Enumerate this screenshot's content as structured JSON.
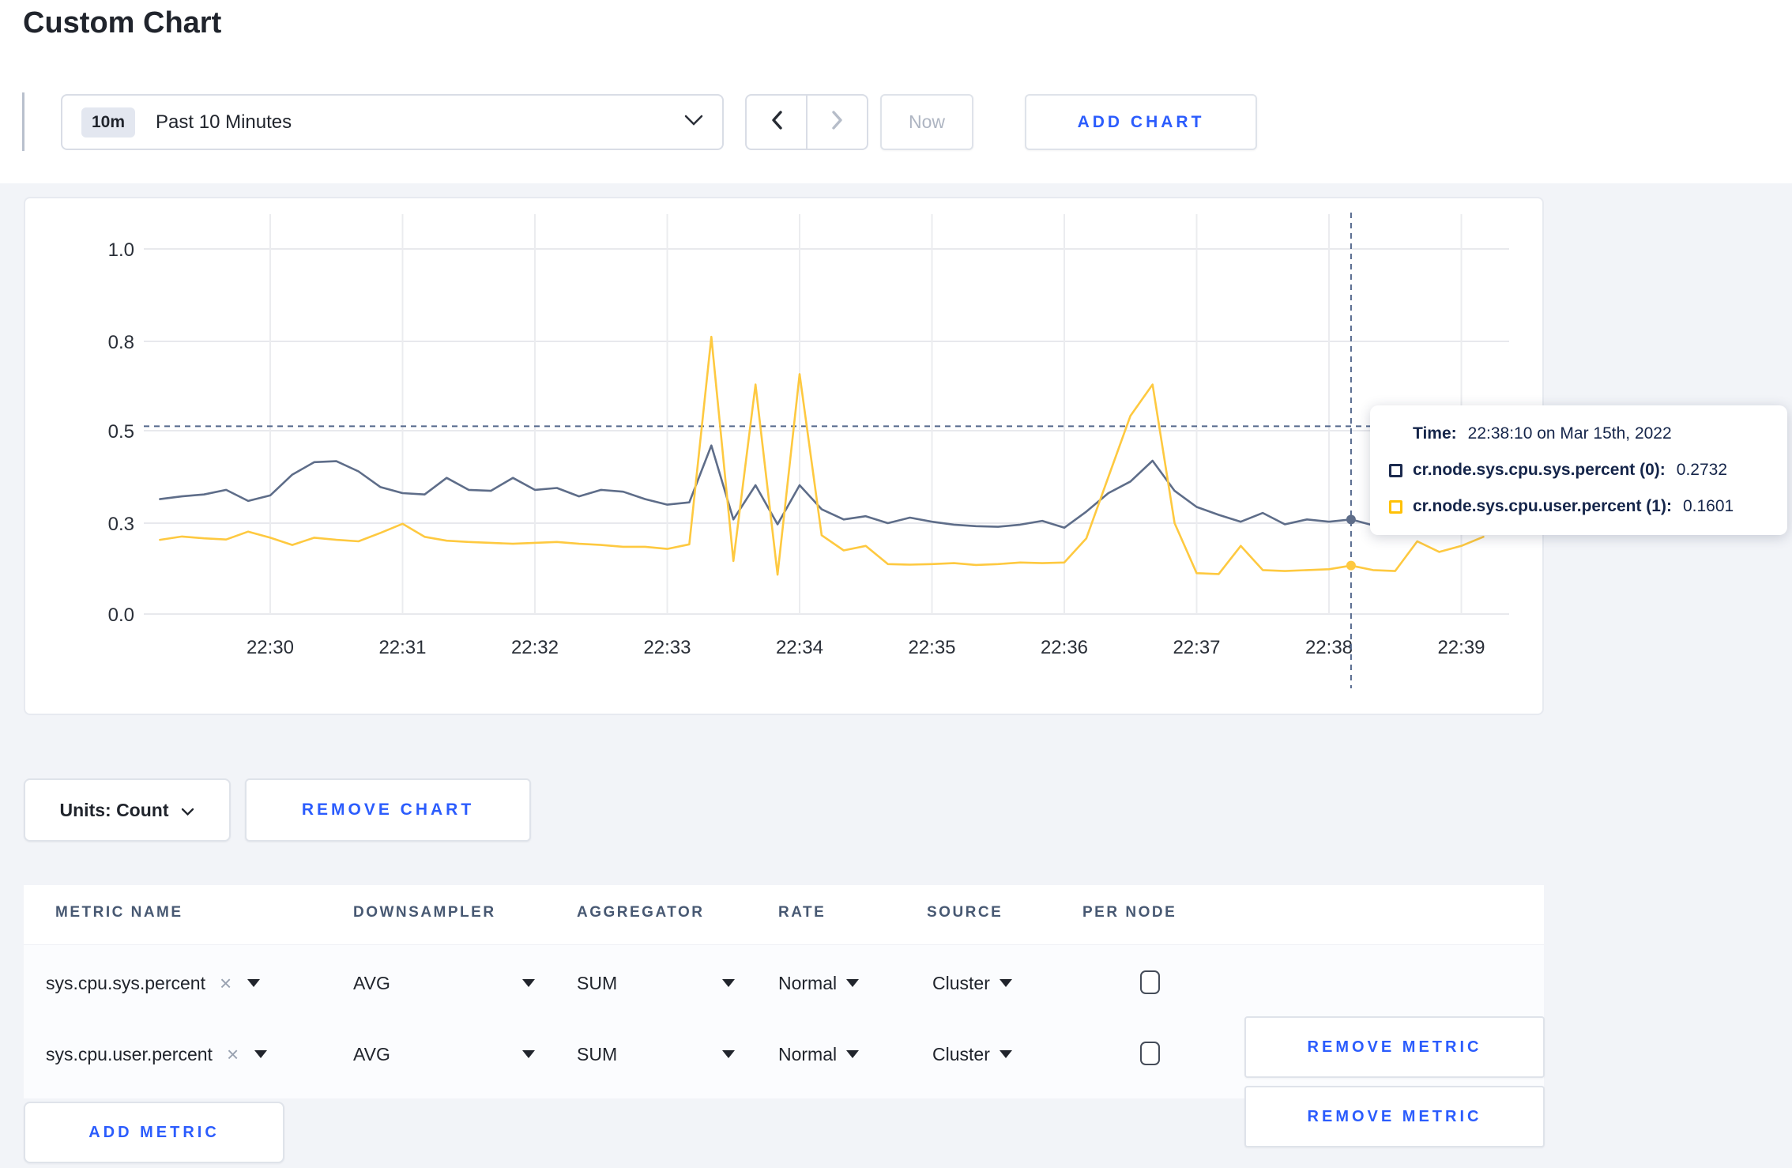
{
  "page": {
    "title": "Custom Chart"
  },
  "toolbar": {
    "range_badge": "10m",
    "range_label": "Past 10 Minutes",
    "now_label": "Now",
    "add_chart_label": "ADD CHART"
  },
  "chart_data": {
    "type": "line",
    "title": "",
    "xlabel": "",
    "ylabel": "",
    "x_ticks": [
      "22:30",
      "22:31",
      "22:32",
      "22:33",
      "22:34",
      "22:35",
      "22:36",
      "22:37",
      "22:38",
      "22:39"
    ],
    "y_ticks": [
      0.0,
      0.3,
      0.5,
      0.8,
      1.0
    ],
    "ylim": [
      0.0,
      1.0
    ],
    "grid": true,
    "sample_interval_seconds": 10,
    "series": [
      {
        "name": "cr.node.sys.cpu.sys.percent (0)",
        "color": "#5e6d89",
        "values": [
          0.352,
          0.358,
          0.362,
          0.372,
          0.348,
          0.36,
          0.405,
          0.432,
          0.434,
          0.412,
          0.378,
          0.365,
          0.362,
          0.398,
          0.372,
          0.37,
          0.398,
          0.372,
          0.376,
          0.358,
          0.372,
          0.368,
          0.352,
          0.34,
          0.345,
          0.468,
          0.308,
          0.382,
          0.296,
          0.382,
          0.33,
          0.308,
          0.315,
          0.3,
          0.312,
          0.303,
          0.295,
          0.29,
          0.288,
          0.295,
          0.305,
          0.285,
          0.325,
          0.365,
          0.39,
          0.435,
          0.37,
          0.335,
          0.318,
          0.303,
          0.322,
          0.296,
          0.308,
          0.303,
          0.308,
          0.293,
          0.3,
          0.318,
          0.298,
          0.308,
          0.315
        ]
      },
      {
        "name": "cr.node.sys.cpu.user.percent (1)",
        "color": "#fec940",
        "values": [
          0.245,
          0.256,
          0.25,
          0.246,
          0.272,
          0.252,
          0.228,
          0.252,
          0.245,
          0.24,
          0.268,
          0.298,
          0.255,
          0.242,
          0.238,
          0.235,
          0.232,
          0.235,
          0.238,
          0.232,
          0.228,
          0.222,
          0.222,
          0.215,
          0.23,
          0.81,
          0.175,
          0.655,
          0.13,
          0.69,
          0.26,
          0.21,
          0.225,
          0.165,
          0.163,
          0.165,
          0.168,
          0.162,
          0.165,
          0.17,
          0.168,
          0.17,
          0.25,
          0.4,
          0.55,
          0.655,
          0.3,
          0.135,
          0.132,
          0.225,
          0.145,
          0.142,
          0.145,
          0.148,
          0.16,
          0.145,
          0.142,
          0.24,
          0.205,
          0.225,
          0.255
        ]
      }
    ],
    "crosshair": {
      "index": 54,
      "time": "22:38:10",
      "y_value": 0.515,
      "color": "#54688c"
    }
  },
  "tooltip": {
    "time_label": "Time:",
    "time_value": "22:38:10 on Mar 15th, 2022",
    "rows": [
      {
        "label": "cr.node.sys.cpu.sys.percent (0):",
        "value": "0.2732",
        "swatch_color": "#1b2a4e"
      },
      {
        "label": "cr.node.sys.cpu.user.percent (1):",
        "value": "0.1601",
        "swatch_color": "#ffc107"
      }
    ]
  },
  "chart_footer": {
    "units_label": "Units: Count",
    "remove_chart_label": "REMOVE CHART"
  },
  "metrics_table": {
    "headers": [
      "METRIC NAME",
      "DOWNSAMPLER",
      "AGGREGATOR",
      "RATE",
      "SOURCE",
      "PER NODE"
    ],
    "rows": [
      {
        "metric": "sys.cpu.sys.percent",
        "downsampler": "AVG",
        "aggregator": "SUM",
        "rate": "Normal",
        "source": "Cluster",
        "per_node_checked": false,
        "remove_label": "REMOVE METRIC"
      },
      {
        "metric": "sys.cpu.user.percent",
        "downsampler": "AVG",
        "aggregator": "SUM",
        "rate": "Normal",
        "source": "Cluster",
        "per_node_checked": false,
        "remove_label": "REMOVE METRIC"
      }
    ],
    "add_metric_label": "ADD METRIC"
  },
  "colors": {
    "accent_blue": "#2b5cfd",
    "navy_text": "#15254a",
    "grid_line": "#e8e9ed",
    "page_background": "#f2f4f8"
  }
}
